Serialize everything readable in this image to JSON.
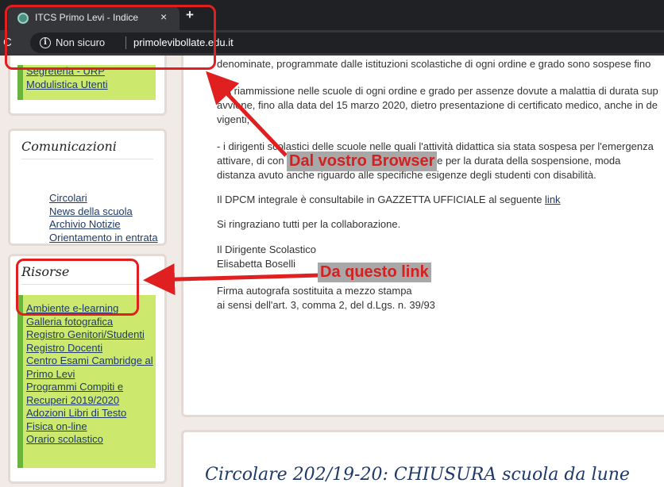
{
  "browser": {
    "tab_title": "ITCS Primo Levi - Indice",
    "tab_close": "×",
    "new_tab": "+",
    "reload": "C",
    "security_label": "Non sicuro",
    "url": "primolevibollate.edu.it"
  },
  "sidebar": {
    "top_links": [
      "Segreteria - URP",
      "Modulistica Utenti"
    ],
    "comunicazioni": {
      "title": "Comunicazioni",
      "links": [
        "Circolari",
        "News della scuola",
        "Archivio Notizie",
        "Orientamento in entrata"
      ]
    },
    "risorse": {
      "title": "Risorse",
      "links": [
        "Ambiente e-learning",
        "Galleria fotografica",
        "Registro Genitori/Studenti",
        "Registro Docenti",
        "Centro Esami Cambridge al",
        "Primo Levi",
        "Programmi Compiti e",
        "Recuperi 2019/2020",
        "Adozioni Libri di Testo",
        "Fisica on-line",
        "Orario scolastico"
      ]
    }
  },
  "article": {
    "p0": "denominate, programmate dalle istituzioni scolastiche di ogni ordine e grado sono sospese fino",
    "p1_l1": "- la riammissione nelle scuole di ogni ordine e grado per assenze dovute a malattia di durata sup",
    "p1_l2": "avviene, fino alla data del 15 marzo 2020, dietro presentazione di certificato medico, anche in de",
    "p1_l3": "vigenti;",
    "p2_l1": "- i dirigenti scolastici delle scuole nelle quali l'attività didattica sia stata sospesa per l'emergenza",
    "p2_l2_a": "attivare, di con",
    "p2_l2_b": "ti e per la durata della sospensione, moda",
    "p2_l3": "distanza avuto anche riguardo alle specifiche esigenze degli studenti con disabilità.",
    "dpcm_text": "Il DPCM integrale è consultabile in GAZZETTA UFFICIALE al seguente ",
    "dpcm_link": "link",
    "thanks": "Si ringraziano tutti per la collaborazione.",
    "sign_role": "Il Dirigente Scolastico",
    "sign_name": "Elisabetta Boselli",
    "sign_note1": "Firma autografa sostituita a mezzo stampa",
    "sign_note2": "ai sensi dell'art. 3, comma 2, del d.Lgs. n. 39/93",
    "next_title": "Circolare 202/19-20: CHIUSURA scuola da lune"
  },
  "annotations": {
    "browser_label": "Dal vostro Browser",
    "link_label": "Da questo link",
    "color": "#e02020"
  }
}
